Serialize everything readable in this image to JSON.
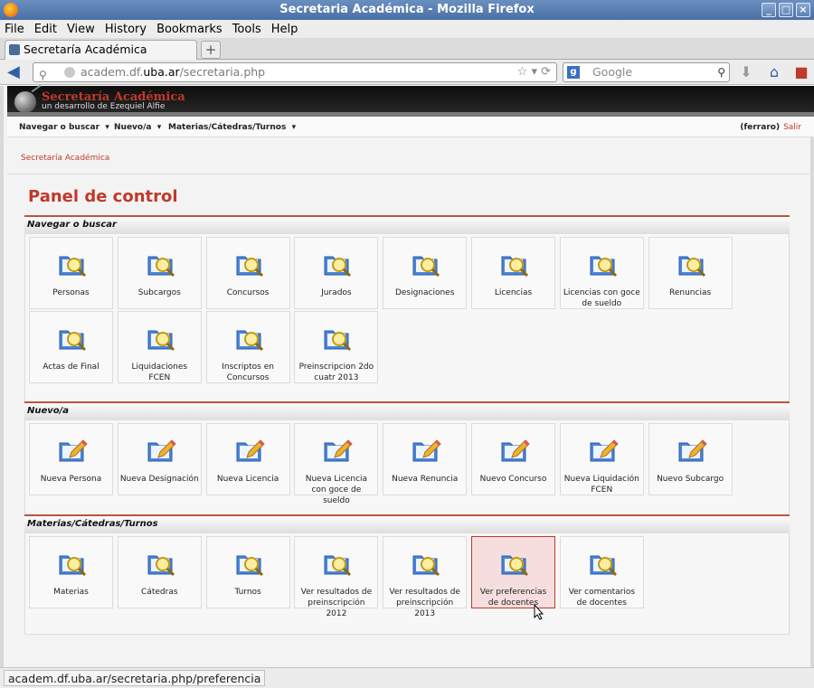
{
  "window": {
    "title": "Secretaria Académica - Mozilla Firefox"
  },
  "menubar": [
    "File",
    "Edit",
    "View",
    "History",
    "Bookmarks",
    "Tools",
    "Help"
  ],
  "tab": {
    "label": "Secretaría Académica"
  },
  "urlbar": {
    "prefix": "academ.df.",
    "domain": "uba.ar",
    "path": "/secretaria.php"
  },
  "search": {
    "placeholder": "Google"
  },
  "banner": {
    "title": "Secretaría Académica",
    "subtitle": "un desarrollo de Ezequiel Alfie"
  },
  "appmenu": {
    "items": [
      "Navegar o buscar",
      "Nuevo/a",
      "Materias/Cátedras/Turnos"
    ],
    "user": "(ferraro)",
    "logout": "Salir"
  },
  "breadcrumb": "Secretaría Académica",
  "page_title": "Panel de control",
  "sections": [
    {
      "title": "Navegar o buscar",
      "icon": "search-folder",
      "tiles": [
        "Personas",
        "Subcargos",
        "Concursos",
        "Jurados",
        "Designaciones",
        "Licencias",
        "Licencias con goce de sueldo",
        "Renuncias",
        "Actas de Final",
        "Liquidaciones FCEN",
        "Inscriptos en Concursos",
        "Preinscripcion 2do cuatr 2013"
      ]
    },
    {
      "title": "Nuevo/a",
      "icon": "edit-pencil",
      "tiles": [
        "Nueva Persona",
        "Nueva Designación",
        "Nueva Licencia",
        "Nueva Licencia con goce de sueldo",
        "Nueva Renuncia",
        "Nuevo Concurso",
        "Nueva Liquidación FCEN",
        "Nuevo Subcargo"
      ]
    },
    {
      "title": "Materias/Cátedras/Turnos",
      "icon": "search-folder",
      "tiles": [
        "Materias",
        "Cátedras",
        "Turnos",
        "Ver resultados de preinscripción 2012",
        "Ver resultados de preinscripción 2013",
        "Ver preferencias de docentes",
        "Ver comentarios de docentes"
      ]
    }
  ],
  "status_bar": "academ.df.uba.ar/secretaria.php/preferencia"
}
